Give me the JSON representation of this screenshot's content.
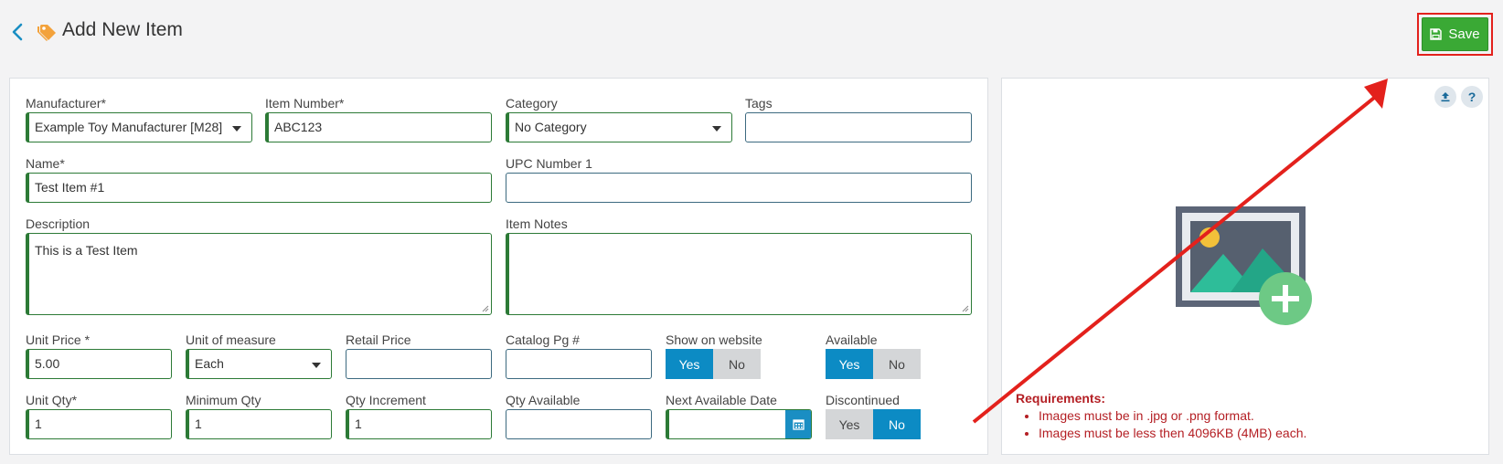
{
  "header": {
    "title": "Add New Item",
    "save_label": "Save"
  },
  "colors": {
    "save_green": "#3aa935",
    "toggle_active": "#0c8bc4",
    "required_border": "#2c7a36",
    "annotation_red": "#e3211c",
    "requirements_text": "#b41f24"
  },
  "icons": {
    "back": "chevron-left-icon",
    "title": "tag-icon",
    "save": "floppy-disk-icon",
    "upload": "upload-icon",
    "help": "question-icon",
    "image_placeholder": "image-add-icon",
    "calendar": "calendar-icon"
  },
  "form": {
    "manufacturer": {
      "label": "Manufacturer*",
      "value": "Example Toy Manufacturer [M28]"
    },
    "item_number": {
      "label": "Item Number*",
      "value": "ABC123"
    },
    "category": {
      "label": "Category",
      "value": "No Category"
    },
    "tags": {
      "label": "Tags",
      "value": ""
    },
    "name": {
      "label": "Name*",
      "value": "Test Item #1"
    },
    "upc": {
      "label": "UPC Number 1",
      "value": ""
    },
    "description": {
      "label": "Description",
      "value": "This is a Test Item"
    },
    "item_notes": {
      "label": "Item Notes",
      "value": ""
    },
    "unit_price": {
      "label": "Unit Price *",
      "value": "5.00"
    },
    "unit_of_measure": {
      "label": "Unit of measure",
      "value": "Each"
    },
    "retail_price": {
      "label": "Retail Price",
      "value": ""
    },
    "catalog_pg": {
      "label": "Catalog Pg #",
      "value": ""
    },
    "show_on_website": {
      "label": "Show on website",
      "yes": "Yes",
      "no": "No",
      "selected": "Yes"
    },
    "available": {
      "label": "Available",
      "yes": "Yes",
      "no": "No",
      "selected": "Yes"
    },
    "unit_qty": {
      "label": "Unit Qty*",
      "value": "1"
    },
    "minimum_qty": {
      "label": "Minimum Qty",
      "value": "1"
    },
    "qty_increment": {
      "label": "Qty Increment",
      "value": "1"
    },
    "qty_available": {
      "label": "Qty Available",
      "value": ""
    },
    "next_available_date": {
      "label": "Next Available Date",
      "value": ""
    },
    "discontinued": {
      "label": "Discontinued",
      "yes": "Yes",
      "no": "No",
      "selected": "No"
    }
  },
  "image_panel": {
    "requirements_title": "Requirements:",
    "requirements": [
      "Images must be in .jpg or .png format.",
      "Images must be less then 4096KB (4MB) each."
    ]
  }
}
